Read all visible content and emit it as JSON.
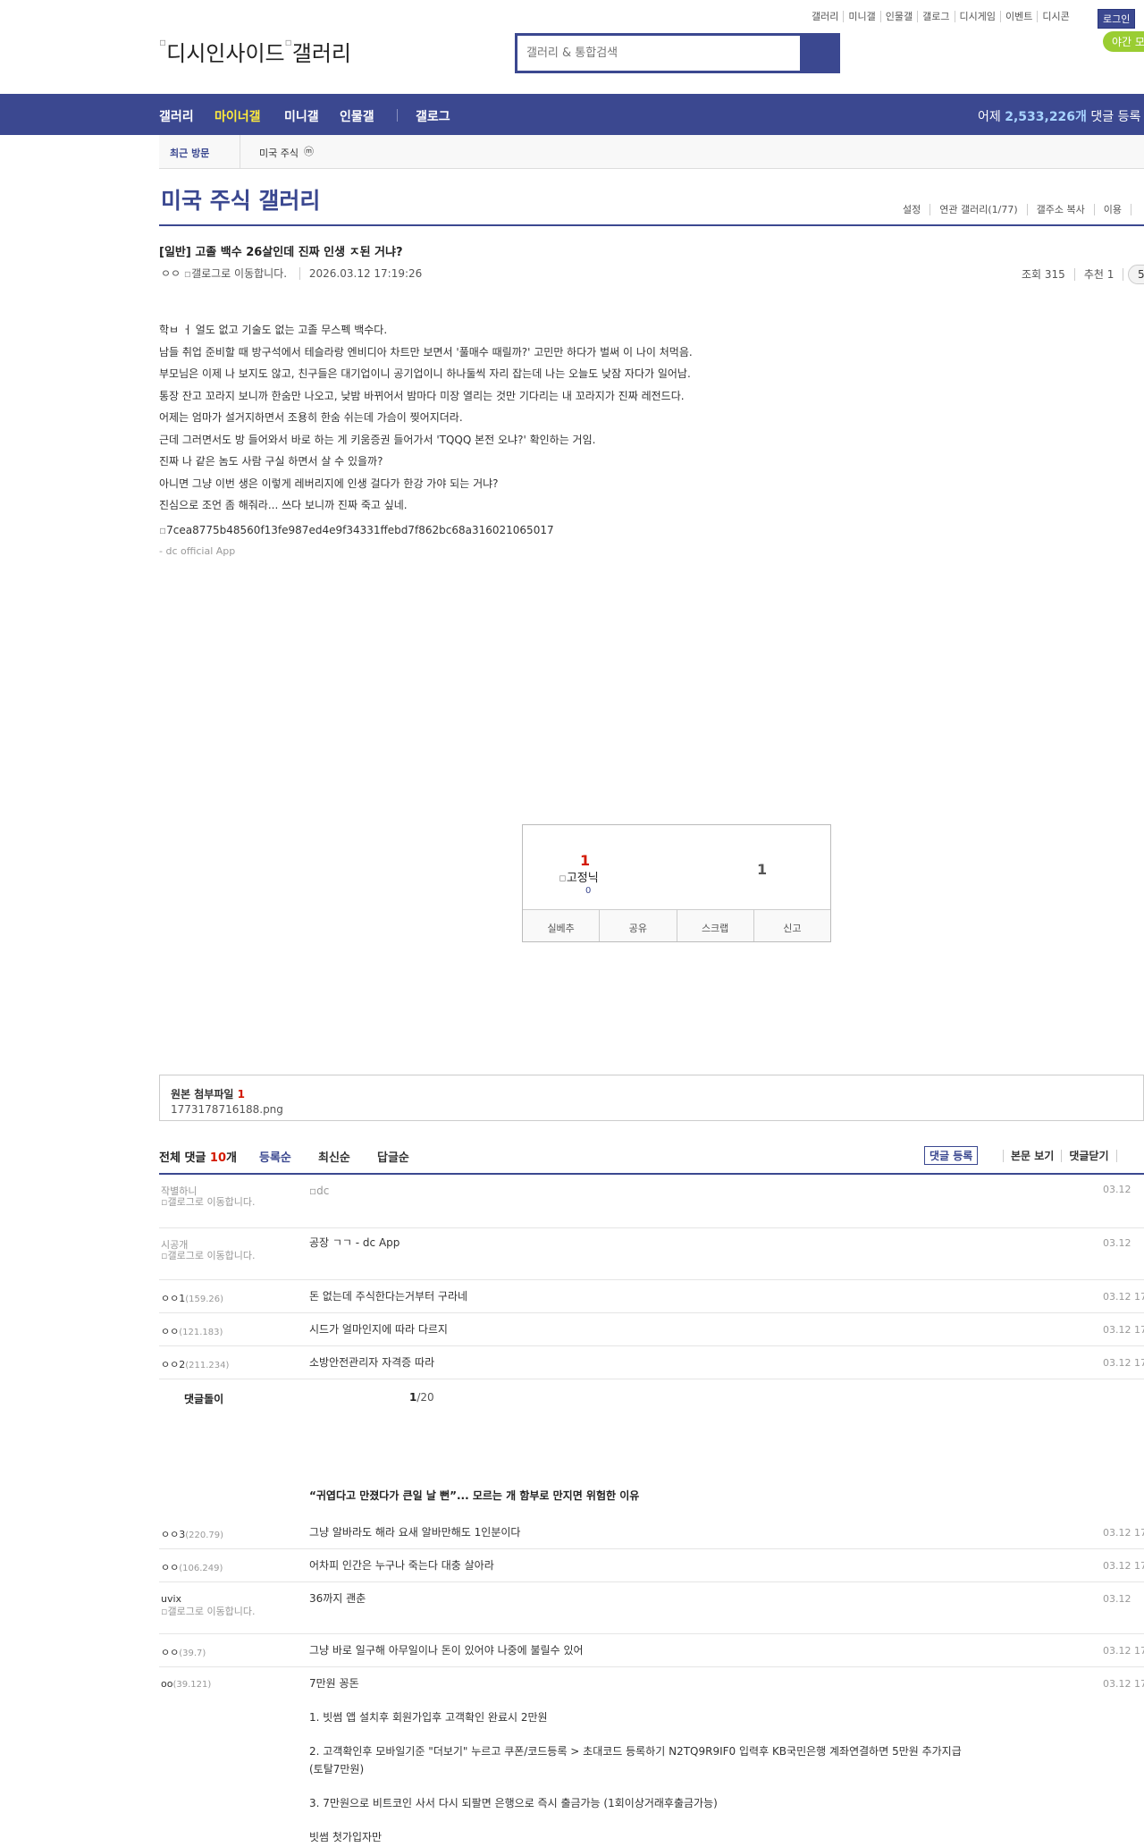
{
  "top_nav": {
    "links": [
      "갤러리",
      "미니갤",
      "인물갤",
      "갤로그",
      "디시게임",
      "이벤트",
      "디시콘"
    ],
    "login": "로그인",
    "night_mode": "야간 모"
  },
  "header": {
    "logo_alt": "디시인사이드",
    "logo2_alt": "갤러리",
    "search_placeholder": "갤러리 & 통합검색"
  },
  "gnb": {
    "items": [
      "갤러리",
      "마이너갤",
      "미니갤",
      "인물갤",
      "갤로그"
    ],
    "yesterday_prefix": "어제",
    "yesterday_count": "2,533,226개",
    "yesterday_suffix": "댓글 등록"
  },
  "recent": {
    "label": "최근 방문",
    "gallery": "미국 주식",
    "close_icon": "ⓜ"
  },
  "gallery": {
    "title": "미국 주식 갤러리",
    "tools": [
      "설정",
      "연관 갤러리(1/77)",
      "갤주소 복사",
      "이용"
    ]
  },
  "post": {
    "title": "[일반] 고졸 백수 26살인데 진짜 인생 ㅈ된 거냐?",
    "author": "ㅇㅇ",
    "gallog_alt": "갤로그로 이동합니다.",
    "date": "2026.03.12 17:19:26",
    "views": "조회 315",
    "recommend": "추천 1",
    "comment_badge": "5",
    "body": [
      "학ㅂ ㅓ 얼도 없고 기술도 없는 고졸 무스펙 백수다.",
      "남들 취업 준비할 때 방구석에서 테슬라랑 엔비디아 차트만 보면서 '풀매수 때릴까?' 고민만 하다가 벌써 이 나이 처먹음.",
      "부모님은 이제 나 보지도 않고, 친구들은 대기업이니 공기업이니 하나둘씩 자리 잡는데 나는 오늘도 낮잠 자다가 일어남.",
      "통장 잔고 꼬라지 보니까 한숨만 나오고, 낮밤 바뀌어서 밤마다 미장 열리는 것만 기다리는 내 꼬라지가 진짜 레전드다.",
      "어제는 엄마가 설거지하면서 조용히 한숨 쉬는데 가슴이 찢어지더라.",
      "근데 그러면서도 방 들어와서 바로 하는 게 키움증권 들어가서 'TQQQ 본전 오냐?' 확인하는 거임.",
      "진짜 나 같은 놈도 사람 구실 하면서 살 수 있을까?",
      "아니면 그냥 이번 생은 이렇게 레버리지에 인생 걸다가 한강 가야 되는 거냐?",
      "진심으로 조언 좀 해줘라... 쓰다 보니까 진짜 죽고 싶네."
    ],
    "image_alt": "7cea8775b48560f13fe987ed4e9f34331ffebd7f862bc68a316021065017",
    "app_sig": "- dc official App"
  },
  "recommend_box": {
    "up": "1",
    "fixed_alt": "고정닉",
    "fixed_count": "0",
    "down": "1",
    "actions": [
      "실베추",
      "공유",
      "스크랩",
      "신고"
    ]
  },
  "attachment": {
    "label": "원본 첨부파일",
    "count": "1",
    "file": "1773178716188.png"
  },
  "comments_header": {
    "total_prefix": "전체 댓글",
    "total_count": "10",
    "total_suffix": "개",
    "sorts": [
      "등록순",
      "최신순",
      "답글순"
    ],
    "register": "댓글 등록",
    "view_post": "본문 보기",
    "close_comments": "댓글닫기"
  },
  "comments": [
    {
      "nick": "작별하니",
      "ip": "",
      "gallog": "갤로그로 이동합니다.",
      "text": "dc",
      "date": "03.12"
    },
    {
      "nick": "시공개",
      "ip": "",
      "gallog": "갤로그로 이동합니다.",
      "text": "공장 ㄱㄱ - dc App",
      "date": "03.12"
    },
    {
      "nick": "ㅇㅇ1",
      "ip": "(159.26)",
      "text": "돈 없는데 주식한다는거부터 구라네",
      "date": "03.12 17"
    },
    {
      "nick": "ㅇㅇ",
      "ip": "(121.183)",
      "text": "시드가 얼마인지에 따라 다르지",
      "date": "03.12 17"
    },
    {
      "nick": "ㅇㅇ2",
      "ip": "(211.234)",
      "text": "소방안전관리자 자격증 따라",
      "date": "03.12 17"
    }
  ],
  "paging": {
    "label": "댓글돌이",
    "current": "1",
    "total": "/20"
  },
  "ad": {
    "title": "“귀엽다고 만졌다가 큰일 날 뻔”... 모르는 개 함부로 만지면 위험한 이유"
  },
  "comments2": [
    {
      "nick": "ㅇㅇ3",
      "ip": "(220.79)",
      "text": "그냥 알바라도 해라 요새 알바만해도 1인분이다",
      "date": "03.12 17"
    },
    {
      "nick": "ㅇㅇ",
      "ip": "(106.249)",
      "text": "어차피 인간은 누구나 죽는다 대충 살아라",
      "date": "03.12 17"
    },
    {
      "nick": "uvix",
      "ip": "",
      "gallog": "갤로그로 이동합니다.",
      "text": "36까지 괜춘",
      "date": "03.12"
    },
    {
      "nick": "ㅇㅇ",
      "ip": "(39.7)",
      "text": "그냥 바로 일구해 아무일이나 돈이 있어야 나중에 불릴수 있어",
      "date": "03.12 17"
    },
    {
      "nick": "oo",
      "ip": "(39.121)",
      "text": "7만원 꽁돈",
      "date": "03.12 17"
    }
  ],
  "ad_comment": [
    "1. 빗썸 앱 설치후 회원가입후 고객확인 완료시 2만원",
    "2. 고객확인후 모바일기준 \"더보기\" 누르고 쿠폰/코드등록 > 초대코드 등록하기  N2TQ9R9IF0 입력후  KB국민은행 계좌연결하면 5만원 추가지급 (토탈7만원)",
    "3. 7만원으로 비트코인 사서 다시 되팔면 은행으로 즉시 출금가능 (1회이상거래후출금가능)",
    "빗썸 첫가입자만"
  ]
}
